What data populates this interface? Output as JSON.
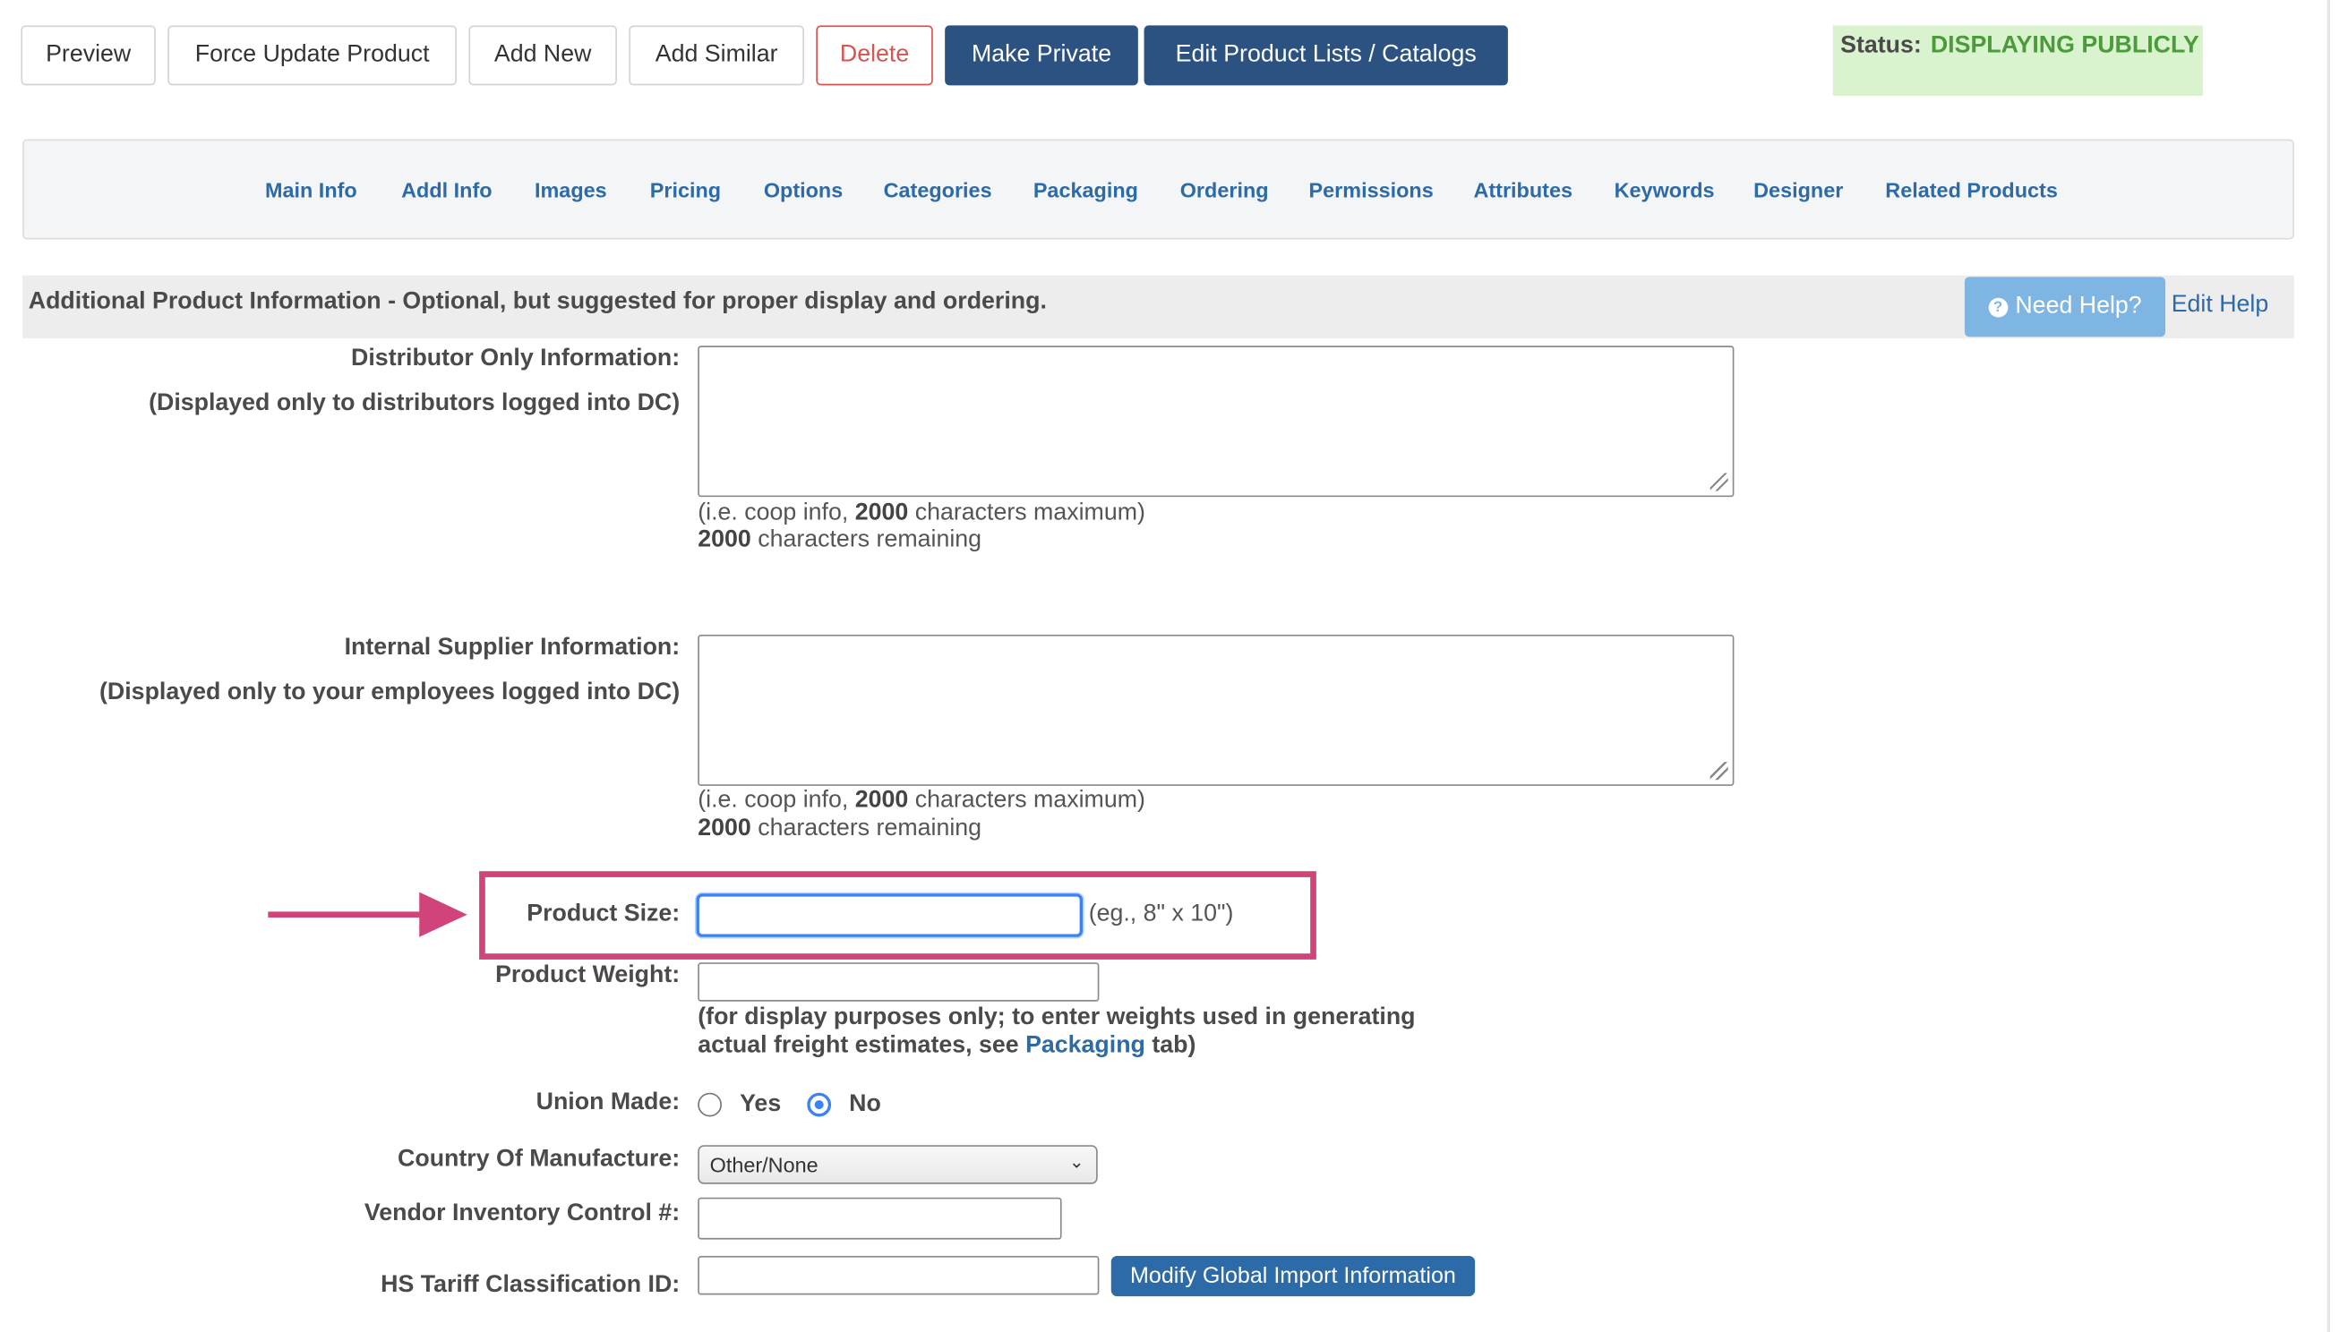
{
  "toolbar": {
    "preview": "Preview",
    "force_update": "Force Update Product",
    "add_new": "Add New",
    "add_similar": "Add Similar",
    "delete": "Delete",
    "make_private": "Make Private",
    "edit_lists": "Edit Product Lists / Catalogs"
  },
  "status": {
    "label": "Status:",
    "value": "DISPLAYING PUBLICLY"
  },
  "nav": {
    "tabs": [
      "Main Info",
      "Addl Info",
      "Images",
      "Pricing",
      "Options",
      "Categories",
      "Packaging",
      "Ordering",
      "Permissions",
      "Attributes",
      "Keywords",
      "Designer",
      "Related Products"
    ]
  },
  "section": {
    "title": "Additional Product Information - Optional, but suggested for proper display and ordering.",
    "help_button": "Need Help?",
    "edit_help": "Edit Help"
  },
  "form": {
    "distributor": {
      "label": "Distributor Only Information:",
      "sublabel": "(Displayed only to distributors logged into DC)",
      "value": "",
      "hint_pre": "(i.e. coop info, ",
      "hint_max": "2000",
      "hint_post": " characters maximum)",
      "remaining_count": "2000",
      "remaining_text": " characters remaining"
    },
    "supplier": {
      "label": "Internal Supplier Information:",
      "sublabel": "(Displayed only to your employees logged into DC)",
      "value": "",
      "hint_pre": "(i.e. coop info, ",
      "hint_max": "2000",
      "hint_post": " characters maximum)",
      "remaining_count": "2000",
      "remaining_text": " characters remaining"
    },
    "product_size": {
      "label": "Product Size:",
      "value": "",
      "example": "(eg., 8\" x 10\")"
    },
    "product_weight": {
      "label": "Product Weight:",
      "value": "",
      "note_line1": "(for display purposes only; to enter weights used in generating",
      "note_line2_pre": "actual freight estimates, see ",
      "note_link": "Packaging",
      "note_line2_post": " tab)"
    },
    "union_made": {
      "label": "Union Made:",
      "yes": "Yes",
      "no": "No",
      "selected": "No"
    },
    "country": {
      "label": "Country Of Manufacture:",
      "value": "Other/None"
    },
    "vendor_inventory": {
      "label": "Vendor Inventory Control #:",
      "value": ""
    },
    "hs_tariff": {
      "label": "HS Tariff Classification ID:",
      "value": "",
      "button": "Modify Global Import Information"
    }
  },
  "colors": {
    "highlight": "#d0437b",
    "primary_dark": "#2c5282",
    "link": "#2c6aa8",
    "status_bg": "#d9f3cf",
    "status_text": "#4b9b3a",
    "danger": "#d9534f"
  },
  "icons": {
    "help": "question-circle-icon",
    "select": "chevron-down-icon",
    "callout": "arrow-right-icon"
  }
}
